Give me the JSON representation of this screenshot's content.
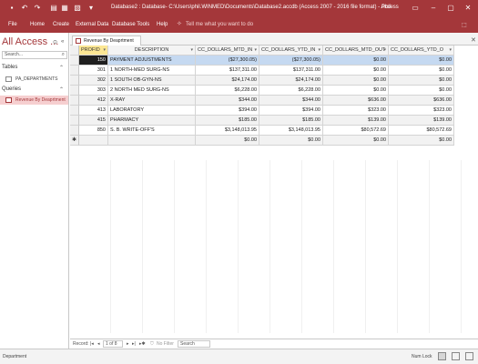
{
  "titlebar": {
    "title": "Database2 : Database- C:\\Users\\phil.WINMED\\Documents\\Database2.accdb (Access 2007 - 2016 file format) - Access",
    "user": "Phil",
    "save_icon": "save-icon",
    "undo_icon": "undo-icon",
    "redo_icon": "redo-icon"
  },
  "ribbon": {
    "tabs": [
      "File",
      "Home",
      "Create",
      "External Data",
      "Database Tools",
      "Help"
    ],
    "tell_me": "Tell me what you want to do"
  },
  "nav": {
    "header": "All Access ...",
    "search_placeholder": "Search...",
    "groups": [
      {
        "label": "Tables",
        "items": [
          "PA_DEPARTMENTS"
        ]
      },
      {
        "label": "Queries",
        "items": [
          "Revenue By Deaprtment"
        ]
      }
    ]
  },
  "document": {
    "tab_label": "Revenue By Deaprtment"
  },
  "datasheet": {
    "columns": [
      "PROFID",
      "DESCRIPTION",
      "CC_DOLLARS_MTD_IN",
      "CC_DOLLARS_YTD_IN",
      "CC_DOLLARS_MTD_OUT",
      "CC_DOLLARS_YTD_O"
    ],
    "rows": [
      [
        "150",
        "PAYMENT ADJUSTMENTS",
        "($27,300.05)",
        "($27,300.05)",
        "$0.00",
        "$0.00"
      ],
      [
        "301",
        "1 NORTH-MED SURG-NS",
        "$137,311.00",
        "$137,311.00",
        "$0.00",
        "$0.00"
      ],
      [
        "302",
        "1 SOUTH OB-GYN-NS",
        "$24,174.00",
        "$24,174.00",
        "$0.00",
        "$0.00"
      ],
      [
        "303",
        "2 NORTH MED SURG-NS",
        "$6,228.00",
        "$6,228.00",
        "$0.00",
        "$0.00"
      ],
      [
        "412",
        "X-RAY",
        "$344.00",
        "$344.00",
        "$636.00",
        "$636.00"
      ],
      [
        "413",
        "LABORATORY",
        "$394.00",
        "$394.00",
        "$323.00",
        "$323.00"
      ],
      [
        "415",
        "PHARMACY",
        "$185.00",
        "$185.00",
        "$139.00",
        "$139.00"
      ],
      [
        "850",
        "S. B. WRITE-OFF'S",
        "$3,148,013.95",
        "$3,148,013.95",
        "$80,572.69",
        "$80,572.69"
      ]
    ],
    "new_row": [
      "",
      "",
      "$0.00",
      "$0.00",
      "$0.00",
      "$0.00"
    ],
    "new_row_marker": "✱"
  },
  "record_nav": {
    "label": "Record:",
    "position": "1 of 8",
    "filter": "No Filter",
    "search": "Search"
  },
  "status": {
    "left": "Department",
    "num_lock": "Num Lock"
  },
  "colors": {
    "accent": "#a4373a",
    "header_highlight": "#fce794",
    "selected_row": "#c5d9f1"
  }
}
